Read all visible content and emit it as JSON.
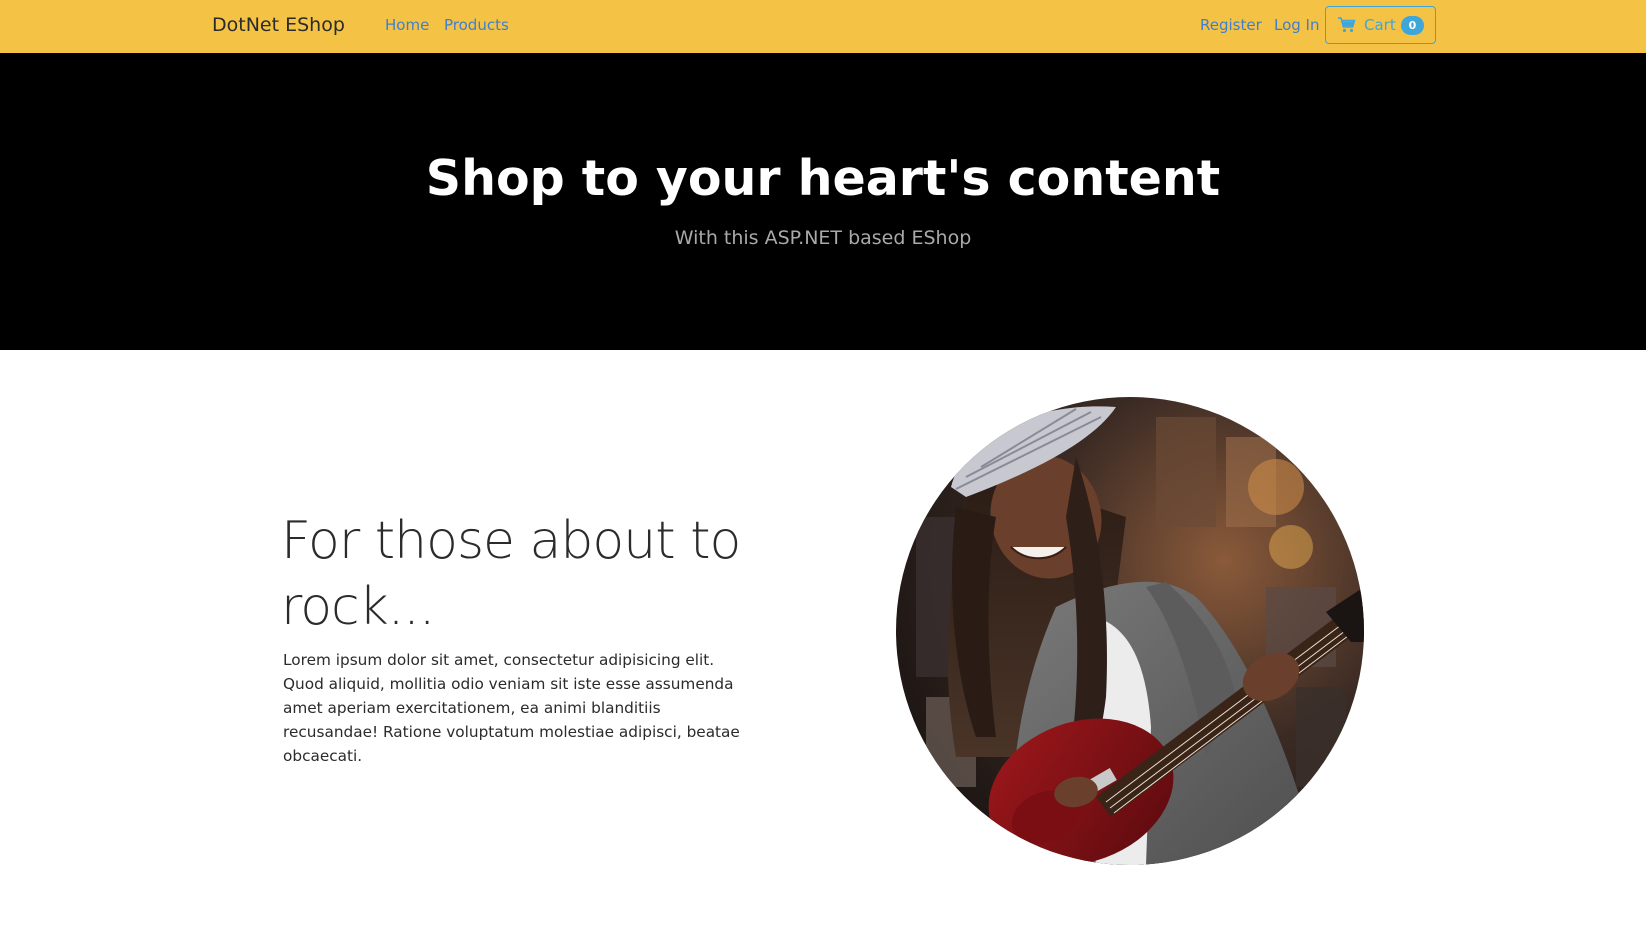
{
  "navbar": {
    "brand": "DotNet EShop",
    "links": {
      "home": "Home",
      "products": "Products",
      "register": "Register",
      "login": "Log In"
    },
    "cart": {
      "icon": "cart-icon",
      "label": "Cart",
      "count": "0"
    },
    "colors": {
      "background": "#f4c345",
      "link": "#3f7fce",
      "cart_accent": "#3ea6d9"
    }
  },
  "hero": {
    "title": "Shop to your heart's content",
    "subtitle": "With this ASP.NET based EShop",
    "colors": {
      "background": "#000000",
      "title": "#ffffff",
      "subtitle": "#a9a9a9"
    }
  },
  "feature": {
    "heading": "For those about to rock...",
    "body": "Lorem ipsum dolor sit amet, consectetur adipisicing elit. Quod aliquid, mollitia odio veniam sit iste esse assumenda amet aperiam exercitationem, ea animi blanditiis recusandae! Ratione voluptatum molestiae adipisci, beatae obcaecati.",
    "image": "woman-playing-red-electric-guitar-photo"
  }
}
